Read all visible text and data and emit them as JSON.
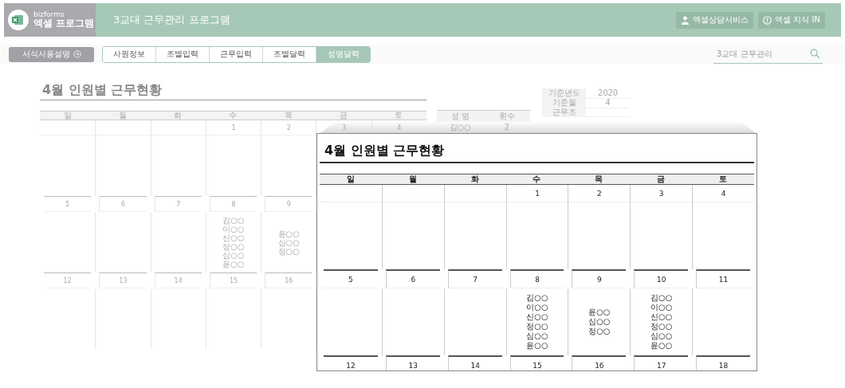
{
  "header": {
    "brand_top": "bizforms",
    "brand_bottom": "엑셀 프로그램",
    "title": "3교대 근무관리 프로그램",
    "buttons": [
      {
        "label": "엑셀상담서비스",
        "kind": "person"
      },
      {
        "label": "엑셀 지식 IN",
        "kind": "info"
      }
    ]
  },
  "nav": {
    "guide_button": "서식사용설명",
    "tabs": [
      {
        "label": "사원정보",
        "selected": false
      },
      {
        "label": "조별입력",
        "selected": false
      },
      {
        "label": "근무입력",
        "selected": false
      },
      {
        "label": "조별달력",
        "selected": false
      },
      {
        "label": "성명달력",
        "selected": true
      }
    ],
    "search": {
      "placeholder": "3교대 근무관리"
    }
  },
  "sheet": {
    "title": "4월 인원별 근무현황",
    "weekdays": [
      "일",
      "월",
      "화",
      "수",
      "목",
      "금",
      "토"
    ],
    "weeks": [
      {
        "days": [
          {
            "date": "1"
          },
          {
            "date": "2"
          },
          {
            "date": "3"
          },
          {
            "date": "4"
          }
        ]
      },
      {
        "days": [
          {
            "date": "5"
          },
          {
            "date": "6"
          },
          {
            "date": "7"
          },
          {
            "date": "8",
            "names": [
              "김○○",
              "이○○",
              "신○○",
              "정○○",
              "심○○",
              "윤○○"
            ]
          },
          {
            "date": "9",
            "names": [
              "윤○○",
              "심○○",
              "정○○"
            ]
          }
        ]
      },
      {
        "days": [
          {
            "date": "12"
          },
          {
            "date": "13"
          },
          {
            "date": "14"
          },
          {
            "date": "15"
          },
          {
            "date": "16"
          }
        ]
      }
    ]
  },
  "roster": {
    "columns": [
      "성 명",
      "횟수"
    ],
    "rows": [
      [
        "김○○",
        "2"
      ]
    ]
  },
  "settings": [
    {
      "label": "기준년도",
      "value": "2020"
    },
    {
      "label": "기준월",
      "value": "4"
    },
    {
      "label": "근무조"
    }
  ],
  "callout": {
    "title": "4월 인원별 근무현황",
    "weekdays": [
      "일",
      "월",
      "화",
      "수",
      "목",
      "금",
      "토"
    ],
    "weeks": [
      {
        "days": [
          {
            "date": "1"
          },
          {
            "date": "2"
          },
          {
            "date": "3"
          },
          {
            "date": "4"
          }
        ]
      },
      {
        "days": [
          {
            "date": "5"
          },
          {
            "date": "6"
          },
          {
            "date": "7"
          },
          {
            "date": "8",
            "names": [
              "김○○",
              "이○○",
              "신○○",
              "정○○",
              "심○○",
              "윤○○"
            ]
          },
          {
            "date": "9",
            "names": [
              "윤○○",
              "심○○",
              "정○○"
            ]
          },
          {
            "date": "10",
            "names": [
              "김○○",
              "이○○",
              "신○○",
              "정○○",
              "심○○",
              "윤○○"
            ]
          },
          {
            "date": "11"
          }
        ]
      },
      {
        "days": [
          {
            "date": "12"
          },
          {
            "date": "13"
          },
          {
            "date": "14"
          },
          {
            "date": "15"
          },
          {
            "date": "16"
          },
          {
            "date": "17"
          },
          {
            "date": "18"
          }
        ]
      }
    ]
  }
}
